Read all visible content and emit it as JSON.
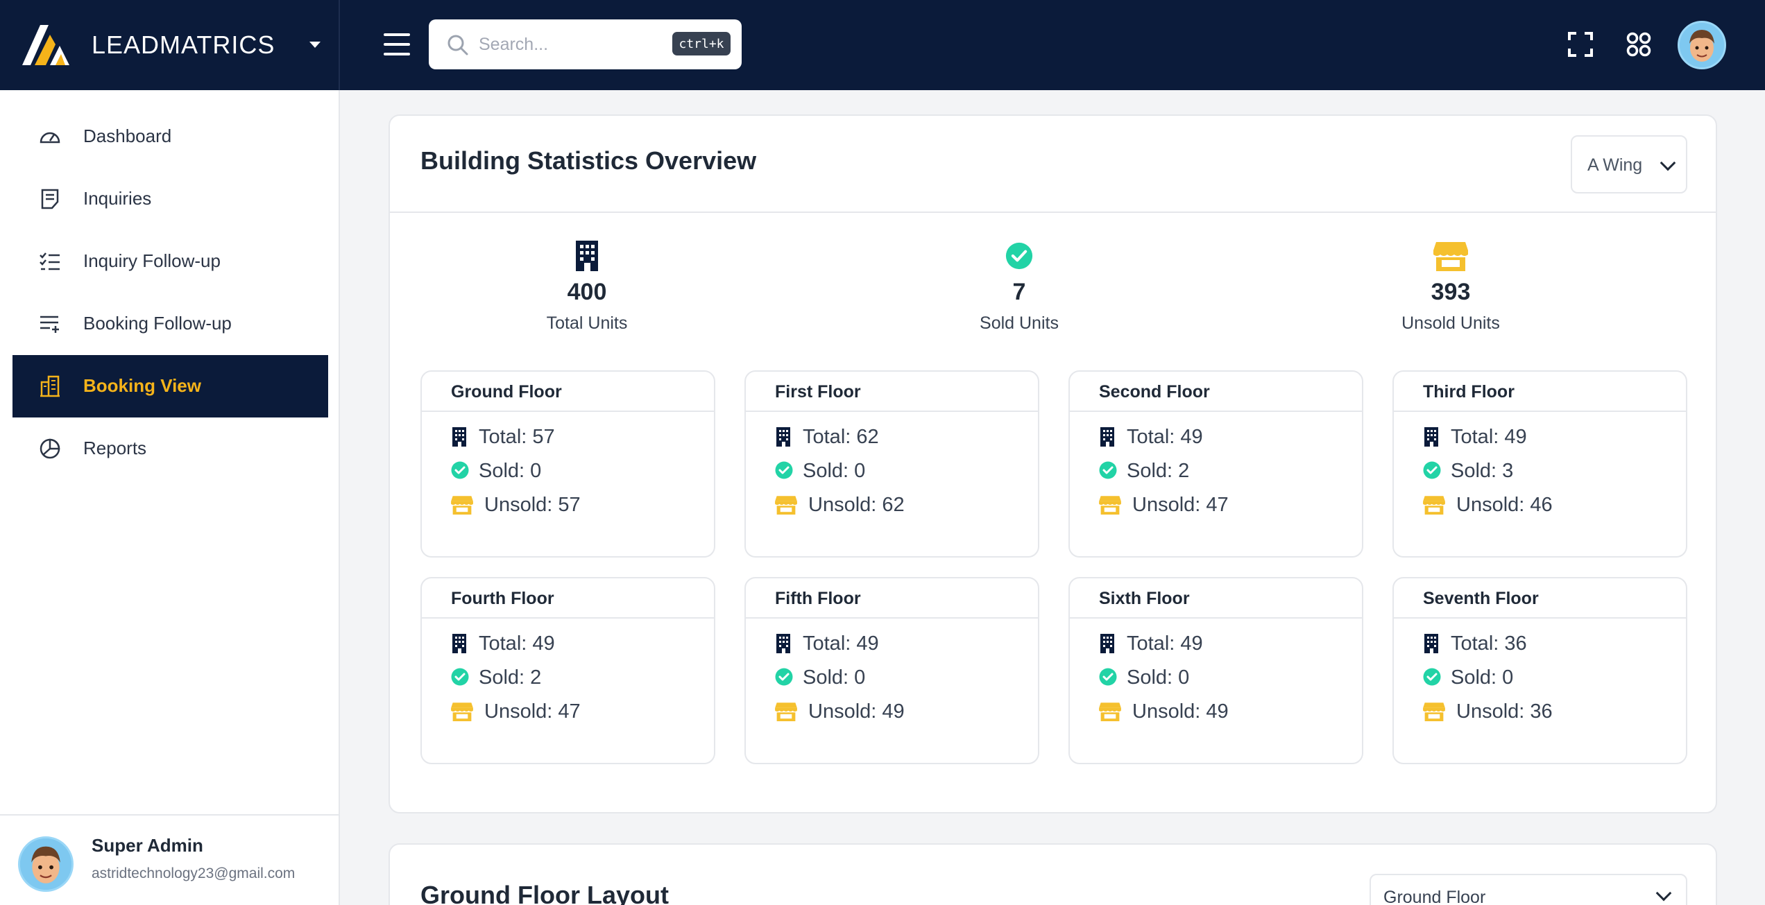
{
  "brand": {
    "name": "LEADMATRICS"
  },
  "search": {
    "placeholder": "Search...",
    "shortcut": "ctrl+k"
  },
  "sidebar": {
    "items": [
      {
        "label": "Dashboard",
        "icon": "gauge-icon",
        "active": false
      },
      {
        "label": "Inquiries",
        "icon": "document-icon",
        "active": false
      },
      {
        "label": "Inquiry Follow-up",
        "icon": "checklist-icon",
        "active": false
      },
      {
        "label": "Booking Follow-up",
        "icon": "list-add-icon",
        "active": false
      },
      {
        "label": "Booking View",
        "icon": "building-icon",
        "active": true
      },
      {
        "label": "Reports",
        "icon": "pie-chart-icon",
        "active": false
      }
    ],
    "user": {
      "name": "Super Admin",
      "email": "astridtechnology23@gmail.com"
    }
  },
  "overview": {
    "title": "Building Statistics Overview",
    "wing_selected": "A Wing",
    "stats": [
      {
        "value": "400",
        "label": "Total Units",
        "icon": "building-icon"
      },
      {
        "value": "7",
        "label": "Sold Units",
        "icon": "check-circle-icon"
      },
      {
        "value": "393",
        "label": "Unsold Units",
        "icon": "store-icon"
      }
    ],
    "floors": [
      {
        "name": "Ground Floor",
        "total": "Total: 57",
        "sold": "Sold: 0",
        "unsold": "Unsold: 57"
      },
      {
        "name": "First Floor",
        "total": "Total: 62",
        "sold": "Sold: 0",
        "unsold": "Unsold: 62"
      },
      {
        "name": "Second Floor",
        "total": "Total: 49",
        "sold": "Sold: 2",
        "unsold": "Unsold: 47"
      },
      {
        "name": "Third Floor",
        "total": "Total: 49",
        "sold": "Sold: 3",
        "unsold": "Unsold: 46"
      },
      {
        "name": "Fourth Floor",
        "total": "Total: 49",
        "sold": "Sold: 2",
        "unsold": "Unsold: 47"
      },
      {
        "name": "Fifth Floor",
        "total": "Total: 49",
        "sold": "Sold: 0",
        "unsold": "Unsold: 49"
      },
      {
        "name": "Sixth Floor",
        "total": "Total: 49",
        "sold": "Sold: 0",
        "unsold": "Unsold: 49"
      },
      {
        "name": "Seventh Floor",
        "total": "Total: 36",
        "sold": "Sold: 0",
        "unsold": "Unsold: 36"
      }
    ]
  },
  "layout": {
    "title": "Ground Floor Layout",
    "floor_selected": "Ground Floor"
  },
  "colors": {
    "navy": "#0b1b3a",
    "accent": "#f5b31a",
    "success": "#22d3a6",
    "unsold": "#f5c02e"
  }
}
